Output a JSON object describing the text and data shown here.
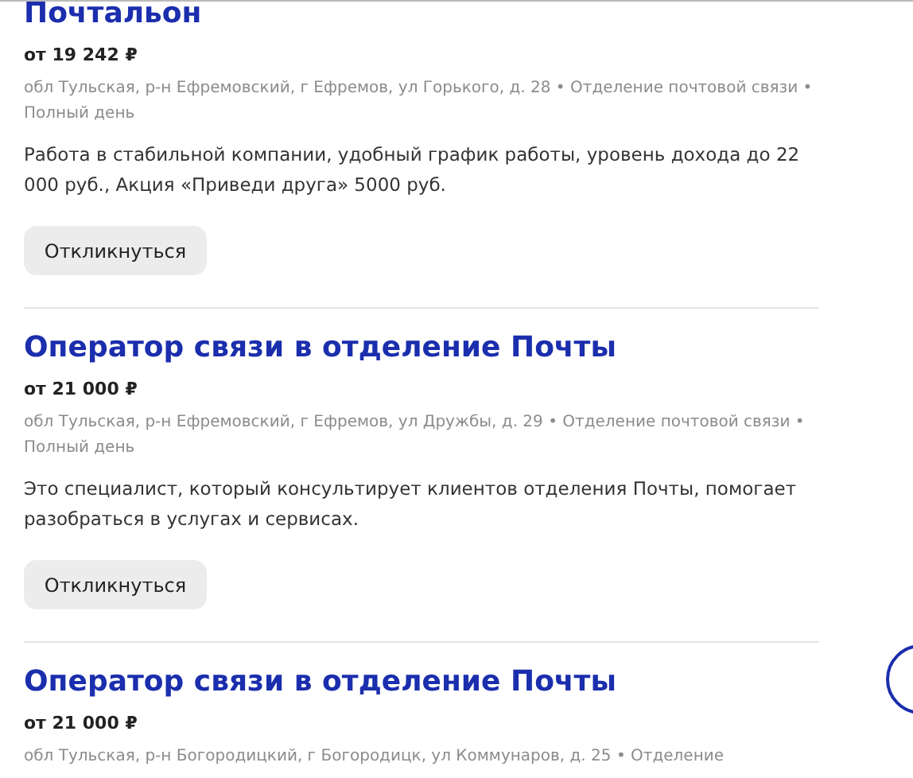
{
  "vacancies": [
    {
      "title": "Почтальон",
      "salary": "от 19 242 ₽",
      "address": "обл Тульская, р-н Ефремовский, г Ефремов, ул Горького, д. 28 • Отделение почтовой связи • Полный день",
      "description": "Работа в стабильной компании, удобный график работы, уровень дохода до 22 000 руб., Акция «Приведи друга» 5000 руб.",
      "button": "Откликнуться"
    },
    {
      "title": "Оператор связи в отделение Почты",
      "salary": "от 21 000 ₽",
      "address": "обл Тульская, р-н Ефремовский, г Ефремов, ул Дружбы, д. 29 • Отделение почтовой связи • Полный день",
      "description": "Это специалист, который консультирует клиентов отделения Почты, помогает разобраться в услугах и сервисах.",
      "button": "Откликнуться"
    },
    {
      "title": "Оператор связи в отделение Почты",
      "salary": "от 21 000 ₽",
      "address": "обл Тульская, р-н Богородицкий, г Богородицк, ул Коммунаров, д. 25 • Отделение"
    }
  ]
}
